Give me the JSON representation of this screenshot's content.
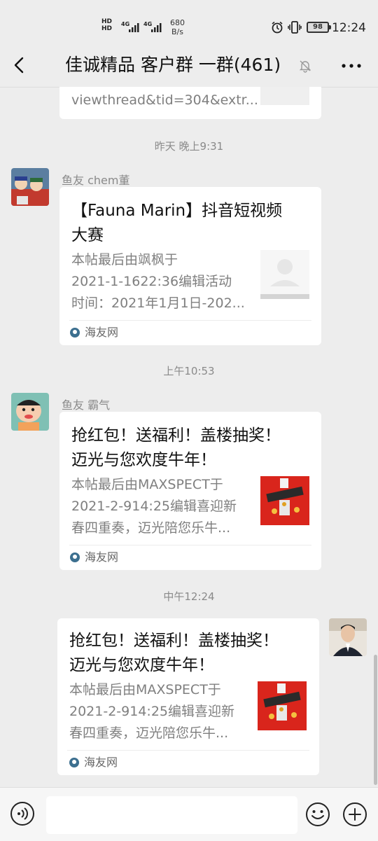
{
  "status_bar": {
    "hd_label_1": "HD",
    "hd_label_2": "HD",
    "network_1": "4G",
    "network_2": "4G",
    "speed_value": "680",
    "speed_unit": "B/s",
    "battery": "98",
    "time": "12:24"
  },
  "header": {
    "title": "佳诚精品 客户群 一群(461)"
  },
  "messages": [
    {
      "partial_line": "viewthread&tid=304&extr..."
    },
    {
      "time": "昨天 晚上9:31",
      "sender": "鱼友 chem董",
      "title_lines": [
        "【Fauna Marin】抖音短视频",
        "大赛"
      ],
      "desc_lines": [
        "本帖最后由飒枫于",
        "2021-1-1622:36编辑活动",
        "时间：2021年1月1日-202..."
      ],
      "source": "海友网"
    },
    {
      "time": "上午10:53",
      "sender": "鱼友 霸气",
      "title_lines": [
        "抢红包！送福利！盖楼抽奖！",
        "迈光与您欢度牛年！"
      ],
      "desc_lines": [
        "本帖最后由MAXSPECT于",
        "2021-2-914:25编辑喜迎新",
        "春四重奏，迈光陪您乐牛..."
      ],
      "source": "海友网"
    },
    {
      "time": "中午12:24",
      "title_lines": [
        "抢红包！送福利！盖楼抽奖！",
        "迈光与您欢度牛年！"
      ],
      "desc_lines": [
        "本帖最后由MAXSPECT于",
        "2021-2-914:25编辑喜迎新",
        "春四重奏，迈光陪您乐牛..."
      ],
      "source": "海友网"
    }
  ],
  "input": {
    "placeholder": ""
  },
  "colors": {
    "background": "#ededed",
    "card": "#ffffff",
    "muted_text": "#7f7f7f",
    "red_thumb": "#d9251c"
  }
}
